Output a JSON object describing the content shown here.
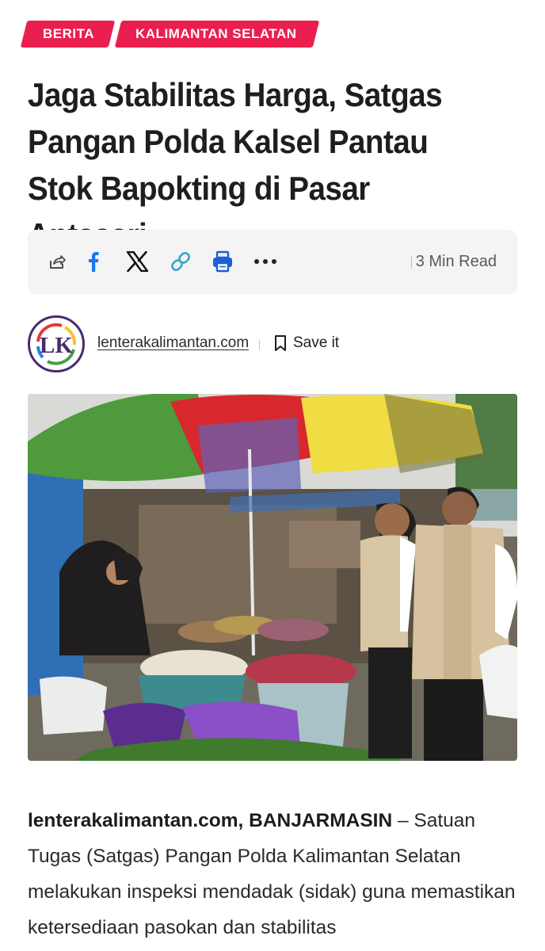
{
  "categories": [
    "BERITA",
    "KALIMANTAN SELATAN"
  ],
  "article": {
    "title": "Jaga Stabilitas Harga, Satgas Pangan Polda Kalsel Pantau Stok Bapokting di Pasar Antasari",
    "read_time": "3 Min Read",
    "author": "lenterakalimantan.com",
    "save_label": "Save it",
    "dateline": "lenterakalimantan.com, BANJARMASIN",
    "lead": " – Satuan Tugas (Satgas) Pangan Polda Kalimantan Selatan melakukan inspeksi mendadak (sidak) guna memastikan ketersediaan pasokan dan stabilitas"
  },
  "share_icons": [
    "share-icon",
    "facebook-icon",
    "x-icon",
    "link-icon",
    "print-icon",
    "more-icon"
  ],
  "avatar_initials": "LK",
  "colors": {
    "accent": "#ea1f50",
    "facebook": "#1877f2",
    "link": "#35a7c9",
    "print": "#1d5fd6",
    "share_bar_bg": "#f4f4f4"
  }
}
